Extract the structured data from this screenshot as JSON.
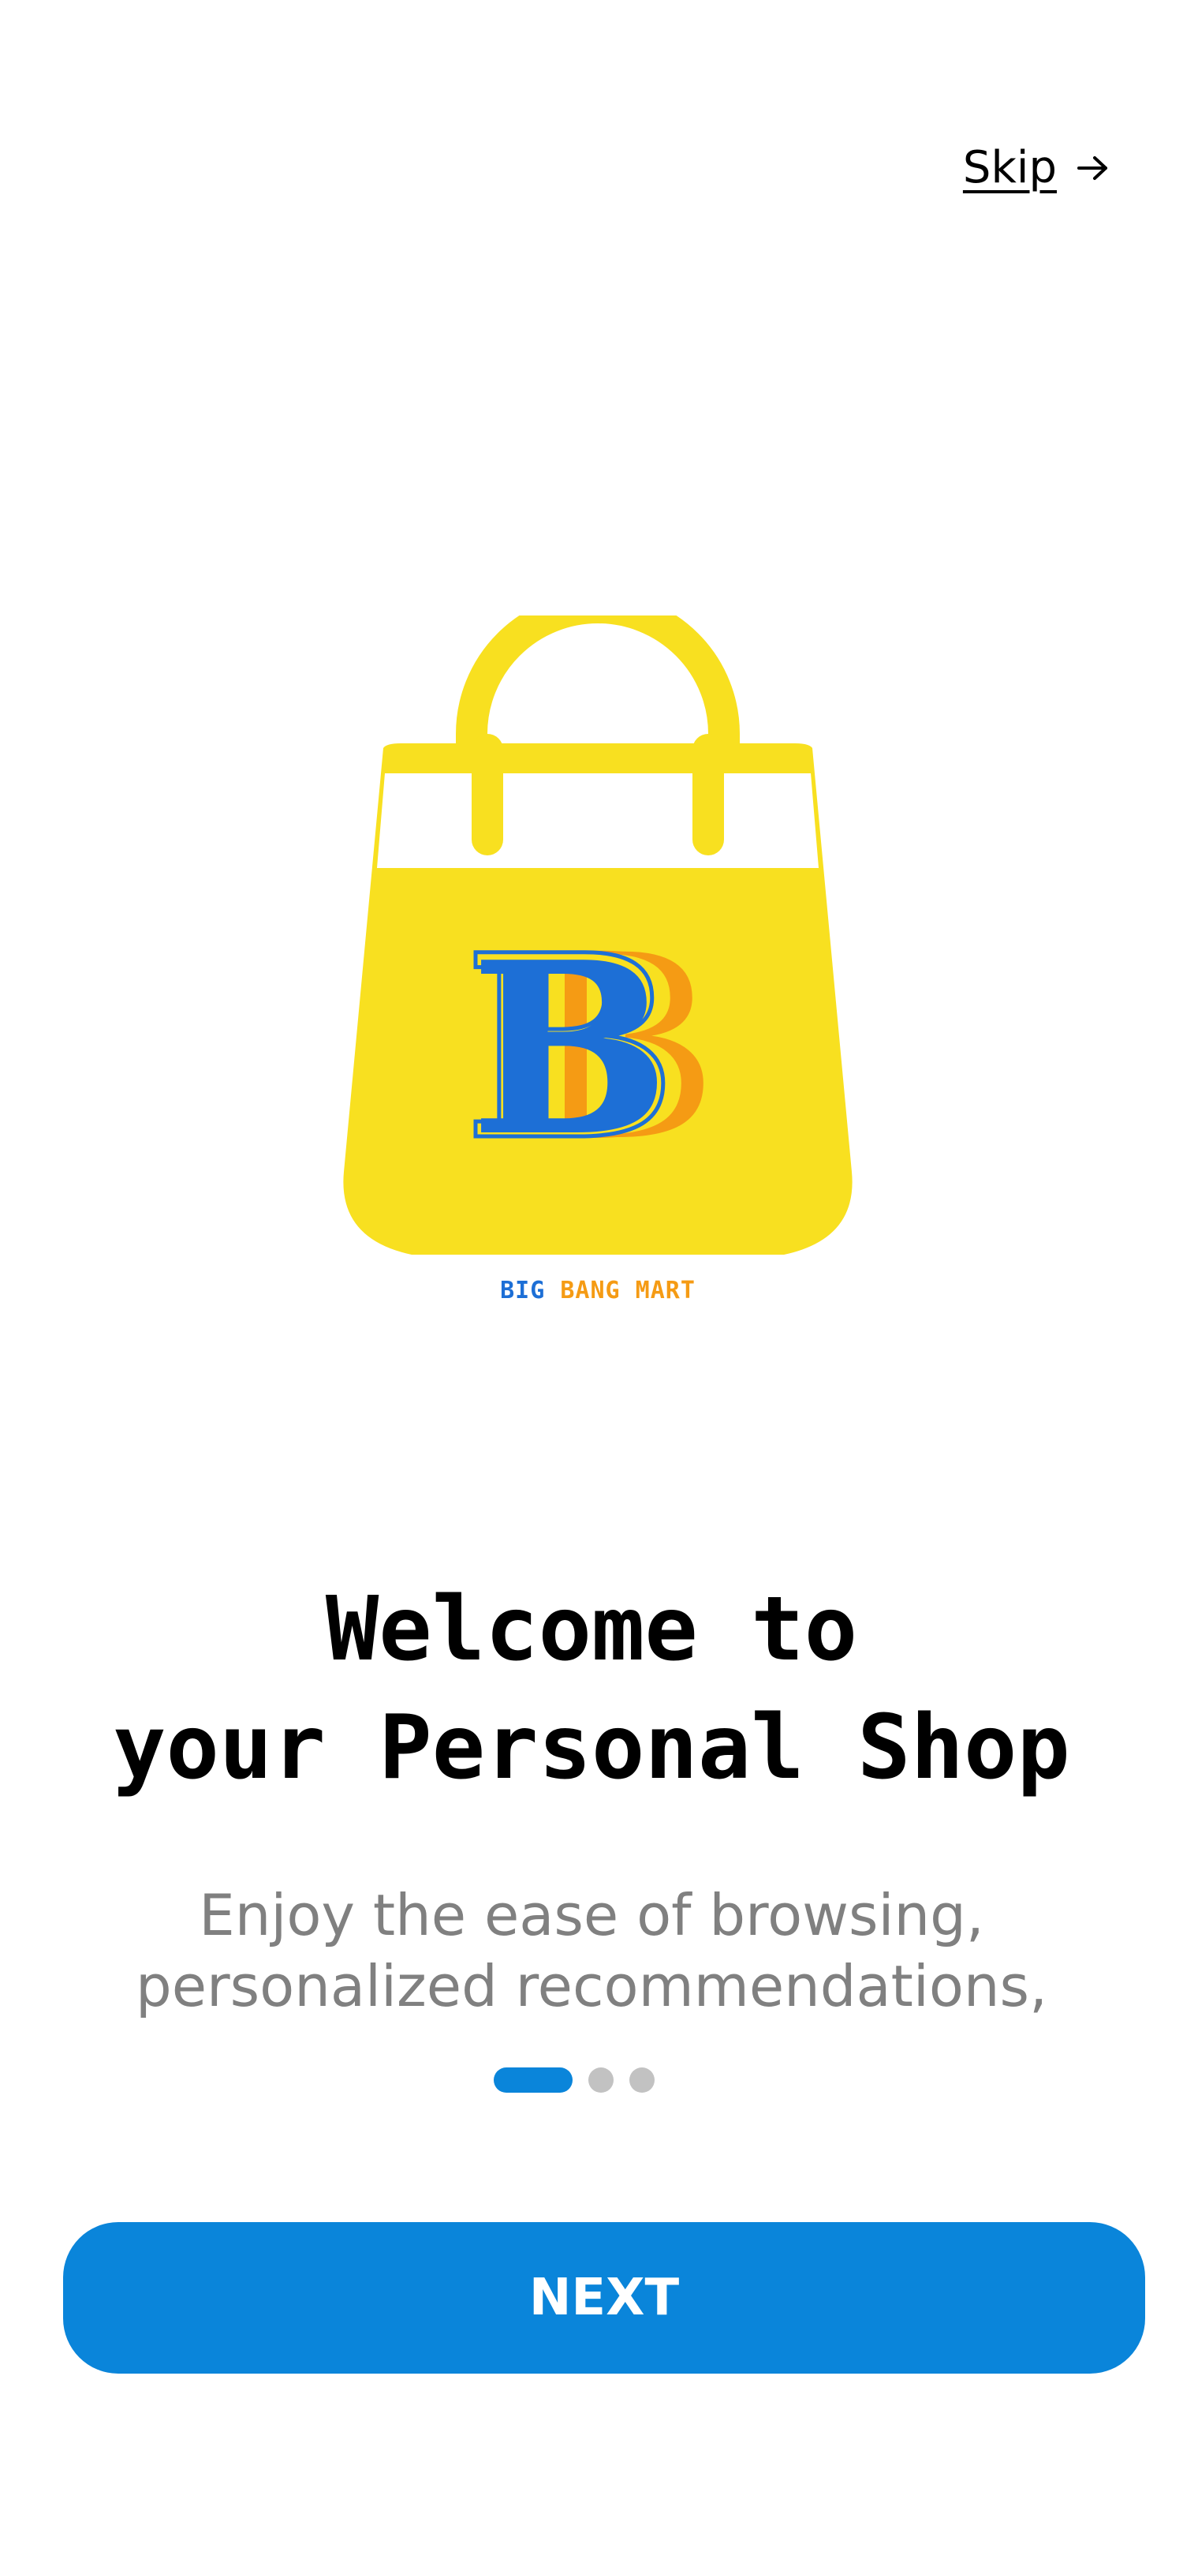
{
  "header": {
    "skip_label": "Skip",
    "skip_icon": "arrow-right-icon"
  },
  "logo": {
    "icon": "shopping-bag-logo-icon",
    "monogram": "BB",
    "brand_words": [
      "BIG",
      "BANG",
      "MART"
    ],
    "colors": {
      "bag": "#f8e020",
      "primary_blue": "#1d6fd6",
      "accent_orange": "#f59b14"
    }
  },
  "onboarding": {
    "title_lines": [
      "Welcome to",
      "your Personal Shop"
    ],
    "subtitle_lines": [
      "Enjoy the ease of browsing,",
      "personalized recommendations,"
    ],
    "pager": {
      "total": 3,
      "active_index": 0
    }
  },
  "actions": {
    "next_label": "NEXT"
  },
  "colors": {
    "accent": "#0a85da",
    "text_primary": "#000000",
    "text_secondary": "#808080",
    "dot_inactive": "#c2c2c2",
    "background": "#ffffff"
  }
}
